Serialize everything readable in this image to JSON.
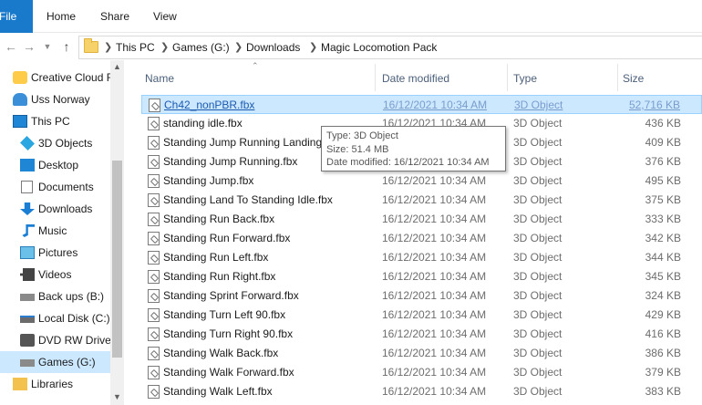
{
  "ribbon": {
    "tabs": [
      "File",
      "Home",
      "Share",
      "View"
    ]
  },
  "address": {
    "crumbs": [
      "This PC",
      "Games (G:)",
      "Downloads",
      "Magic Locomotion Pack"
    ]
  },
  "sidebar": {
    "items": [
      {
        "label": "Creative Cloud F",
        "icon": "creative-cloud-icon"
      },
      {
        "label": "Uss Norway",
        "icon": "user-folder-icon"
      },
      {
        "label": "This PC",
        "icon": "computer-icon"
      },
      {
        "label": "3D Objects",
        "icon": "3d-objects-icon"
      },
      {
        "label": "Desktop",
        "icon": "desktop-icon"
      },
      {
        "label": "Documents",
        "icon": "documents-icon"
      },
      {
        "label": "Downloads",
        "icon": "downloads-icon"
      },
      {
        "label": "Music",
        "icon": "music-icon"
      },
      {
        "label": "Pictures",
        "icon": "pictures-icon"
      },
      {
        "label": "Videos",
        "icon": "videos-icon"
      },
      {
        "label": "Back ups (B:)",
        "icon": "drive-icon"
      },
      {
        "label": "Local Disk (C:)",
        "icon": "local-disk-icon"
      },
      {
        "label": "DVD RW Drive",
        "icon": "dvd-drive-icon"
      },
      {
        "label": "Games (G:)",
        "icon": "drive-icon"
      },
      {
        "label": "Libraries",
        "icon": "libraries-icon"
      }
    ]
  },
  "columns": {
    "name": "Name",
    "date": "Date modified",
    "type": "Type",
    "size": "Size"
  },
  "files": [
    {
      "name": "Ch42_nonPBR.fbx",
      "date": "16/12/2021 10:34 AM",
      "type": "3D Object",
      "size": "52,716 KB"
    },
    {
      "name": "standing idle.fbx",
      "date": "16/12/2021 10:34 AM",
      "type": "3D Object",
      "size": "436 KB"
    },
    {
      "name": "Standing Jump Running Landing",
      "date": "16/12/2021 10:34 AM",
      "type": "3D Object",
      "size": "409 KB"
    },
    {
      "name": "Standing Jump Running.fbx",
      "date": "16/12/2021 10:34 AM",
      "type": "3D Object",
      "size": "376 KB"
    },
    {
      "name": "Standing Jump.fbx",
      "date": "16/12/2021 10:34 AM",
      "type": "3D Object",
      "size": "495 KB"
    },
    {
      "name": "Standing Land To Standing Idle.fbx",
      "date": "16/12/2021 10:34 AM",
      "type": "3D Object",
      "size": "375 KB"
    },
    {
      "name": "Standing Run Back.fbx",
      "date": "16/12/2021 10:34 AM",
      "type": "3D Object",
      "size": "333 KB"
    },
    {
      "name": "Standing Run Forward.fbx",
      "date": "16/12/2021 10:34 AM",
      "type": "3D Object",
      "size": "342 KB"
    },
    {
      "name": "Standing Run Left.fbx",
      "date": "16/12/2021 10:34 AM",
      "type": "3D Object",
      "size": "344 KB"
    },
    {
      "name": "Standing Run Right.fbx",
      "date": "16/12/2021 10:34 AM",
      "type": "3D Object",
      "size": "345 KB"
    },
    {
      "name": "Standing Sprint Forward.fbx",
      "date": "16/12/2021 10:34 AM",
      "type": "3D Object",
      "size": "324 KB"
    },
    {
      "name": "Standing Turn Left 90.fbx",
      "date": "16/12/2021 10:34 AM",
      "type": "3D Object",
      "size": "429 KB"
    },
    {
      "name": "Standing Turn Right 90.fbx",
      "date": "16/12/2021 10:34 AM",
      "type": "3D Object",
      "size": "416 KB"
    },
    {
      "name": "Standing Walk Back.fbx",
      "date": "16/12/2021 10:34 AM",
      "type": "3D Object",
      "size": "386 KB"
    },
    {
      "name": "Standing Walk Forward.fbx",
      "date": "16/12/2021 10:34 AM",
      "type": "3D Object",
      "size": "379 KB"
    },
    {
      "name": "Standing Walk Left.fbx",
      "date": "16/12/2021 10:34 AM",
      "type": "3D Object",
      "size": "383 KB"
    }
  ],
  "tooltip": {
    "type": "Type: 3D Object",
    "size": "Size: 51.4 MB",
    "date": "Date modified: 16/12/2021 10:34 AM"
  },
  "colors": {
    "accent": "#1979ca",
    "selection": "#cce8ff",
    "selection_border": "#99d1ff",
    "header_text": "#4c607a"
  }
}
